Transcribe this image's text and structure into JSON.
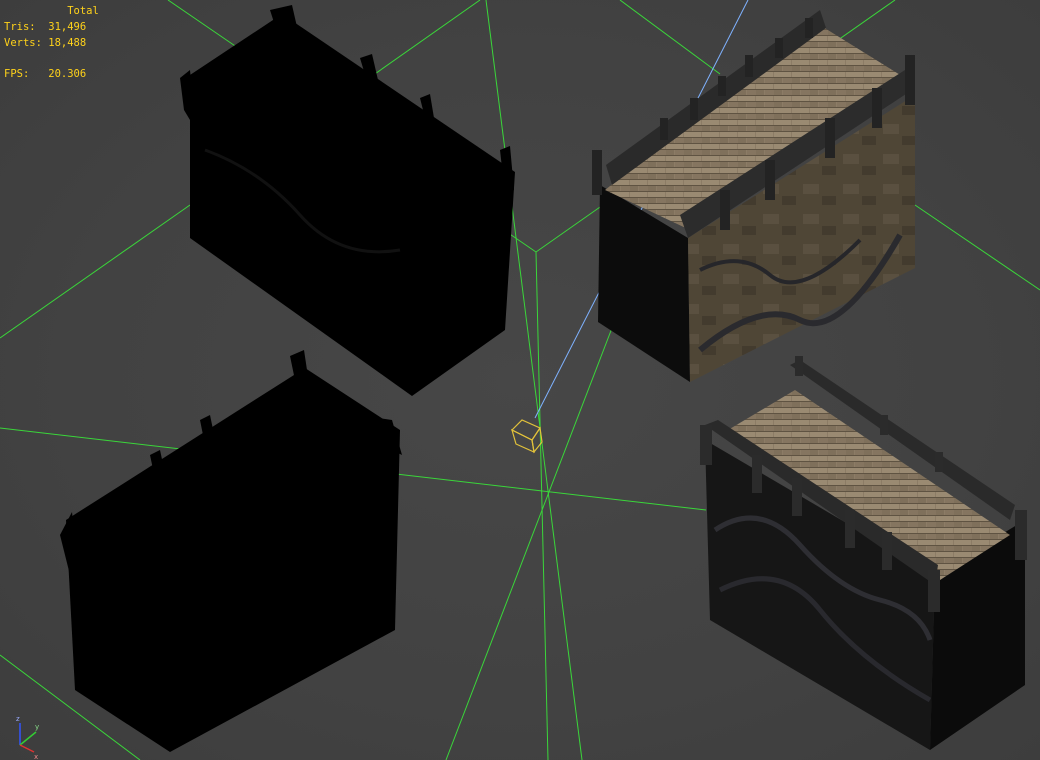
{
  "viewport": {
    "name": "3D Perspective Viewport",
    "background": "#444444",
    "grid_color": "#3ad63a",
    "selection_line_color": "#7fb2ff"
  },
  "stats": {
    "header": "Total",
    "tris_label": "Tris:",
    "tris_value": "31,496",
    "verts_label": "Verts:",
    "verts_value": "18,488",
    "fps_label": "FPS:",
    "fps_value": "20.306",
    "text_color": "#ffd21a"
  },
  "objects": [
    {
      "name": "building-untextured-top-left",
      "textured": false
    },
    {
      "name": "building-textured-top-right",
      "textured": true
    },
    {
      "name": "building-untextured-bottom-left",
      "textured": false
    },
    {
      "name": "building-textured-bottom-right",
      "textured": true
    }
  ],
  "camera_gizmo": {
    "icon": "camera-box-icon",
    "color": "#e2c23a"
  },
  "axis_tripod": {
    "icon": "axis-tripod-icon",
    "x_color": "#d33",
    "y_color": "#3c3",
    "z_color": "#35f"
  }
}
